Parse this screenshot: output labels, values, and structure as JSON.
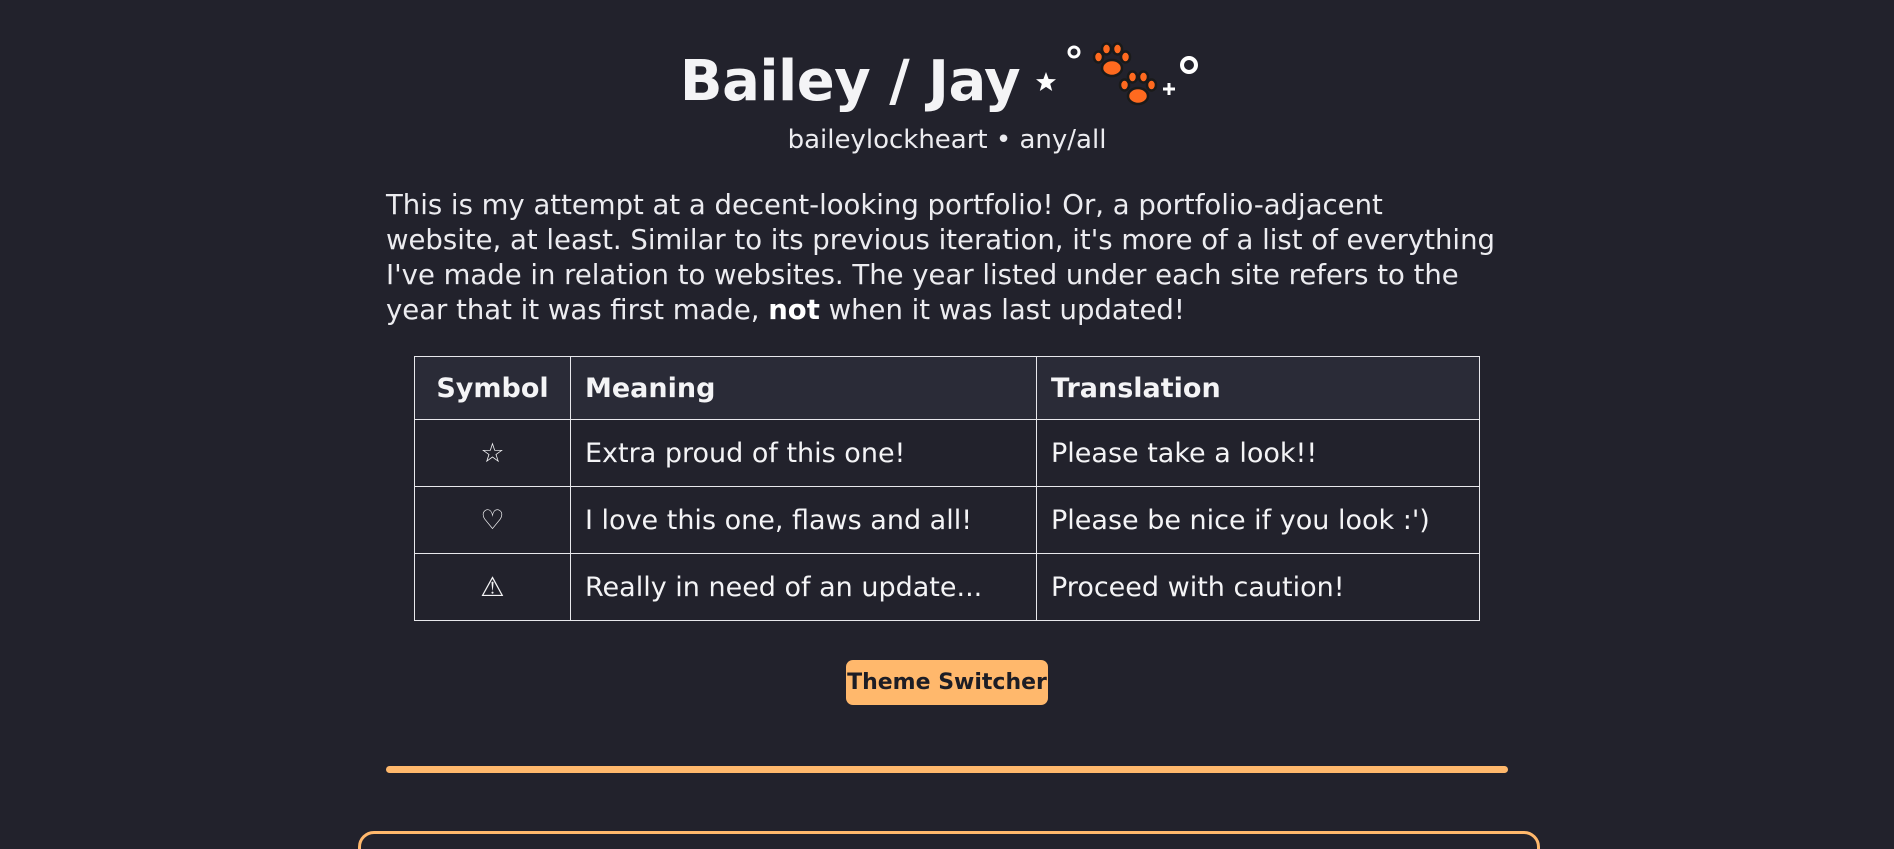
{
  "header": {
    "title": "Bailey / Jay",
    "subtitle": "baileylockheart • any/all"
  },
  "intro": {
    "before_bold": "This is my attempt at a decent-looking portfolio! Or, a portfolio-adjacent website, at least. Similar to its previous iteration, it's more of a list of everything I've made in relation to websites. The year listed under each site refers to the year that it was first made, ",
    "bold": "not",
    "after_bold": " when it was last updated!"
  },
  "legend_table": {
    "headers": [
      "Symbol",
      "Meaning",
      "Translation"
    ],
    "rows": [
      {
        "symbol": "☆",
        "meaning": "Extra proud of this one!",
        "translation": "Please take a look!!"
      },
      {
        "symbol": "♡",
        "meaning": "I love this one, flaws and all!",
        "translation": "Please be nice if you look :')"
      },
      {
        "symbol": "⚠",
        "meaning": "Really in need of an update...",
        "translation": "Proceed with caution!"
      }
    ]
  },
  "theme_switcher": {
    "label": "Theme Switcher"
  },
  "colors": {
    "background": "#22222c",
    "accent": "#ffb86c",
    "paw": "#ff6a1f",
    "table_header_bg": "#2a2b37"
  },
  "icons": {
    "title_decoration": [
      "sparkle-star-icon",
      "circle-icon",
      "paw-print-icon",
      "paw-print-icon",
      "plus-sparkle-icon",
      "circle-icon"
    ]
  }
}
